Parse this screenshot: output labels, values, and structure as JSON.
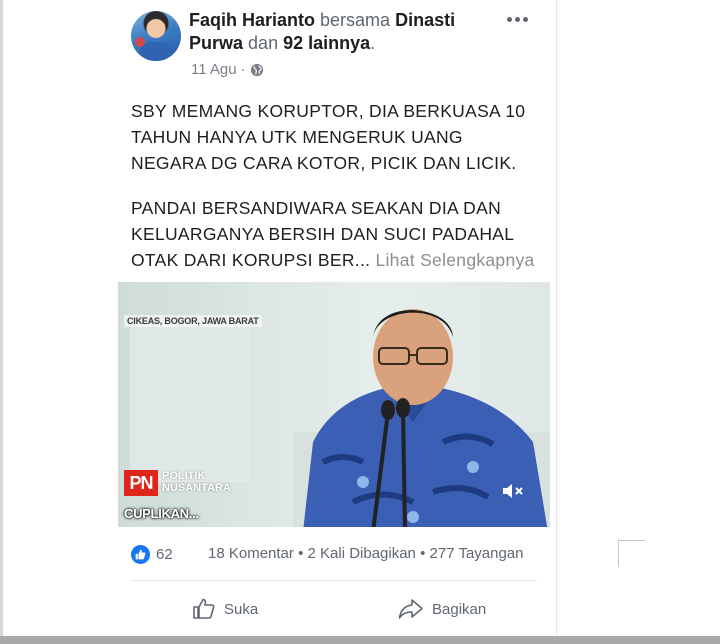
{
  "post": {
    "author_name": "Faqih Harianto",
    "with_word": "bersama",
    "tagged_name": "Dinasti Purwa",
    "and_word": "dan",
    "others": "92 lainnya",
    "date": "11 Agu",
    "privacy_icon": "globe-icon",
    "paragraph1": [
      "SBY MEMANG KORUPTOR, DIA BERKUASA 10",
      "TAHUN HANYA UTK MENGERUK UANG",
      "NEGARA DG CARA KOTOR, PICIK DAN LICIK."
    ],
    "paragraph2": [
      "PANDAI BERSANDIWARA SEAKAN DIA DAN",
      "KELUARGANYA BERSIH DAN SUCI PADAHAL"
    ],
    "paragraph2_last": "OTAK DARI KORUPSI BER...",
    "see_more": "Lihat Selengkapnya"
  },
  "video": {
    "location_caption": "CIKEAS, BOGOR, JAWA BARAT",
    "logo_abbr": "PN",
    "logo_line1": "POLITIK",
    "logo_line2": "NUSANTARA",
    "caption": "CUPLIKAN...",
    "mute_icon": "muted-speaker-icon"
  },
  "engagement": {
    "like_count": "62",
    "comments": "18 Komentar",
    "shares": "2 Kali Dibagikan",
    "views": "277 Tayangan",
    "separator": "•"
  },
  "actions": {
    "like_label": "Suka",
    "share_label": "Bagikan"
  },
  "colors": {
    "accent": "#1877f2",
    "text": "#1c1e21",
    "muted": "#606770"
  }
}
